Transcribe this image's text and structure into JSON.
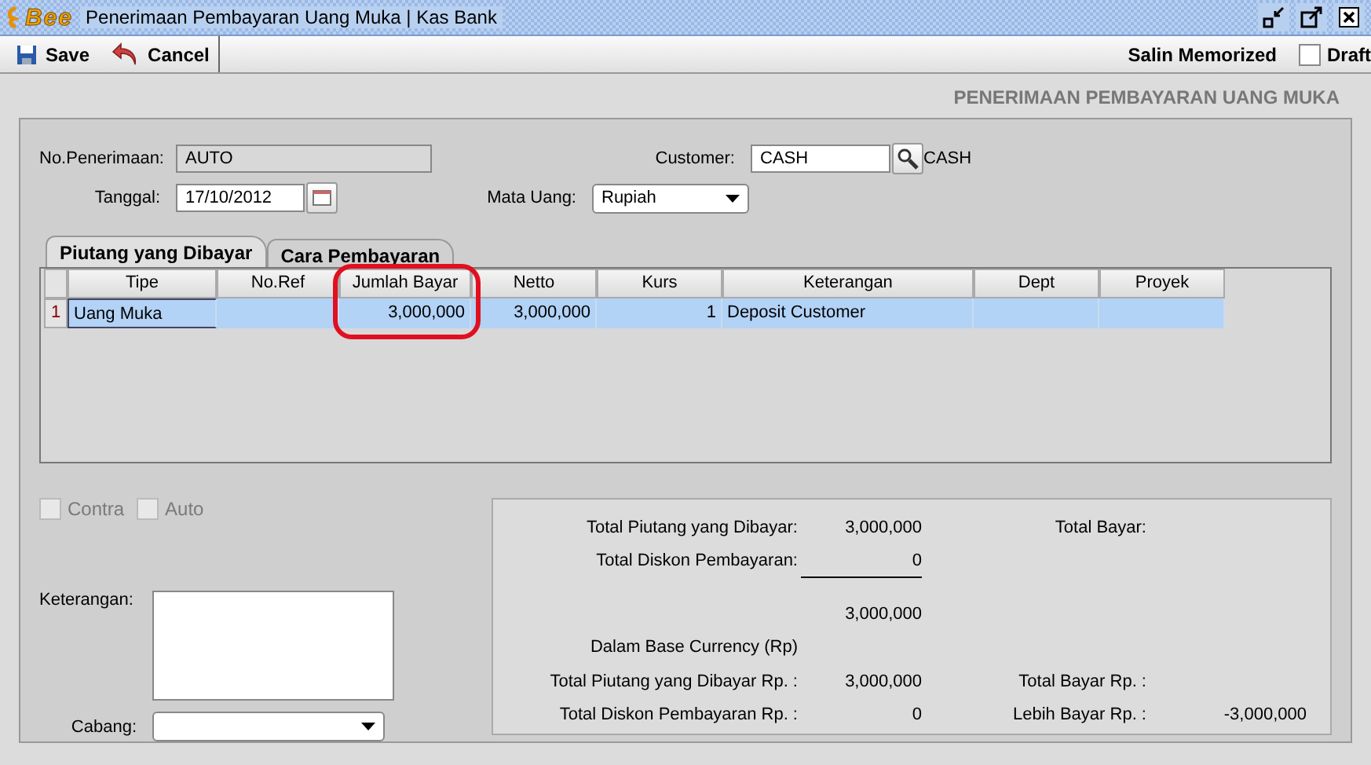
{
  "window": {
    "logo": "Bee",
    "title": "Penerimaan Pembayaran Uang Muka | Kas Bank"
  },
  "toolbar": {
    "buttons": [
      {
        "kind": "save",
        "label": "Save"
      },
      {
        "kind": "cancel",
        "label": "Cancel"
      }
    ],
    "memorized": "Salin Memorized",
    "draft": {
      "label": "Draft",
      "checked": false
    }
  },
  "heading": "PENERIMAAN PEMBAYARAN UANG MUKA",
  "form": {
    "no_penerimaan": {
      "label": "No.Penerimaan:",
      "value": "AUTO"
    },
    "tanggal": {
      "label": "Tanggal:",
      "value": "17/10/2012"
    },
    "customer": {
      "label": "Customer:",
      "value": "CASH",
      "name": "CASH"
    },
    "mata_uang": {
      "label": "Mata Uang:",
      "value": "Rupiah"
    }
  },
  "tabs": [
    {
      "label": "Piutang yang Dibayar",
      "selected": true
    },
    {
      "label": "Cara Pembayaran",
      "selected": false
    }
  ],
  "table": {
    "columns": [
      {
        "label": "Tipe",
        "kind": "text",
        "annotated": false
      },
      {
        "label": "No.Ref",
        "kind": "text",
        "annotated": false
      },
      {
        "label": "Jumlah Bayar",
        "kind": "number",
        "annotated": true
      },
      {
        "label": "Netto",
        "kind": "number",
        "annotated": false
      },
      {
        "label": "Kurs",
        "kind": "number",
        "annotated": false
      },
      {
        "label": "Keterangan",
        "kind": "text",
        "annotated": false
      },
      {
        "label": "Dept",
        "kind": "text",
        "annotated": false
      },
      {
        "label": "Proyek",
        "kind": "text",
        "annotated": false
      }
    ],
    "rows": [
      {
        "number": "1",
        "selected": true,
        "cells": [
          "Uang Muka",
          "",
          "3,000,000",
          "3,000,000",
          "1",
          "Deposit Customer",
          "",
          ""
        ]
      }
    ]
  },
  "options": [
    {
      "label": "Contra",
      "checked": false,
      "disabled": true
    },
    {
      "label": "Auto",
      "checked": false,
      "disabled": true
    }
  ],
  "keterangan": {
    "label": "Keterangan:"
  },
  "cabang": {
    "label": "Cabang:"
  },
  "summary": {
    "total_piutang": {
      "label": "Total Piutang yang Dibayar:",
      "value": "3,000,000"
    },
    "total_diskon": {
      "label": "Total Diskon Pembayaran:",
      "value": "0"
    },
    "subtotal": "3,000,000",
    "total_bayar": {
      "label": "Total Bayar:"
    },
    "base_currency": "Dalam Base Currency (Rp)",
    "total_piutang_rp": {
      "label": "Total Piutang yang Dibayar Rp. :",
      "value": "3,000,000"
    },
    "total_diskon_rp": {
      "label": "Total Diskon Pembayaran Rp. :",
      "value": "0"
    },
    "total_bayar_rp": {
      "label": "Total Bayar Rp. :"
    },
    "lebih_bayar_rp": {
      "label": "Lebih Bayar Rp. :",
      "value": "-3,000,000"
    }
  }
}
